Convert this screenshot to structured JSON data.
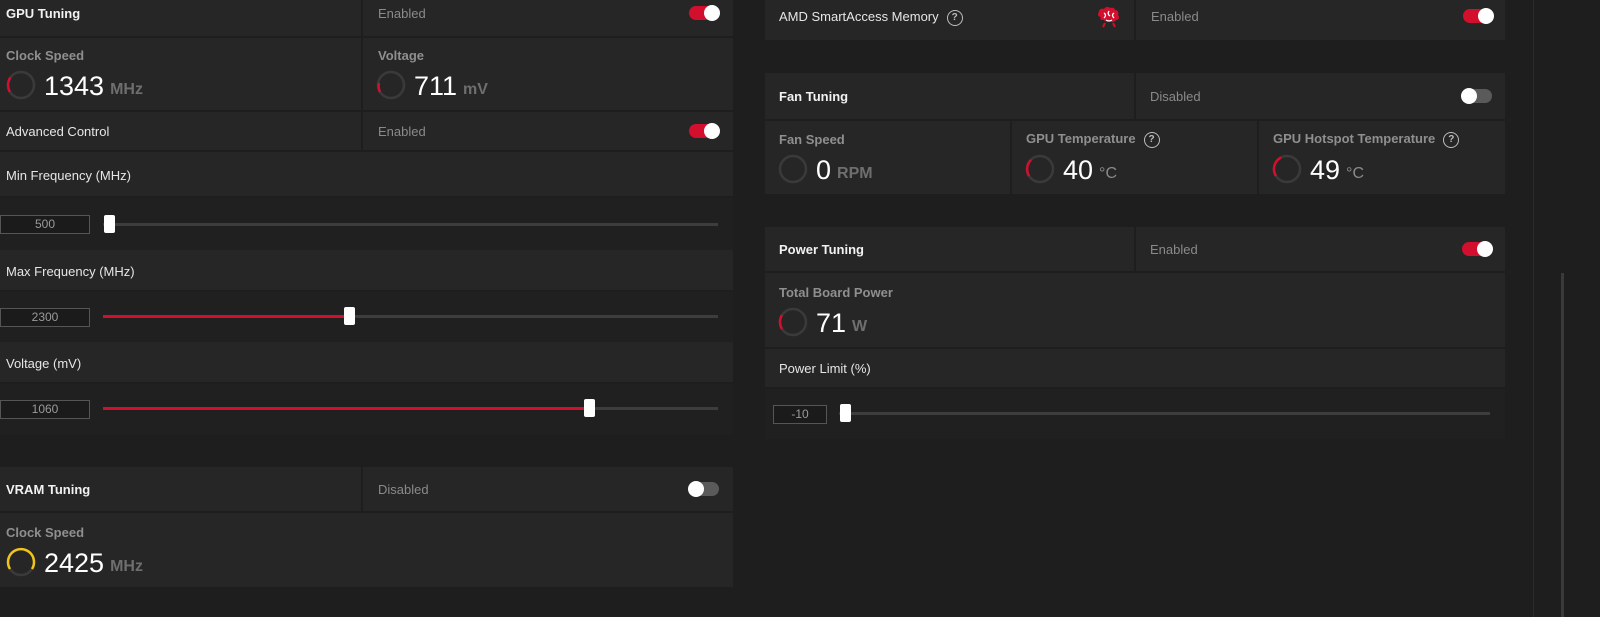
{
  "colors": {
    "accent": "#d2102e",
    "vram_gauge": "#f0c419",
    "background": "#1e1e1e",
    "panel": "#262626"
  },
  "gpu_tuning": {
    "title": "GPU Tuning",
    "state": "Enabled",
    "enabled": true,
    "clock_speed": {
      "label": "Clock Speed",
      "value": "1343",
      "unit": "MHz"
    },
    "voltage": {
      "label": "Voltage",
      "value": "711",
      "unit": "mV"
    },
    "advanced_control": {
      "label": "Advanced Control",
      "state": "Enabled",
      "enabled": true
    },
    "min_frequency": {
      "label": "Min Frequency (MHz)",
      "value": "500",
      "slider_fraction": 0.0
    },
    "max_frequency": {
      "label": "Max Frequency (MHz)",
      "value": "2300",
      "slider_fraction": 0.4
    },
    "voltage_slider": {
      "label": "Voltage (mV)",
      "value": "1060",
      "slider_fraction": 0.79
    }
  },
  "vram_tuning": {
    "title": "VRAM Tuning",
    "state": "Disabled",
    "enabled": false,
    "clock_speed": {
      "label": "Clock Speed",
      "value": "2425",
      "unit": "MHz"
    }
  },
  "smart_access": {
    "label": "AMD SmartAccess Memory",
    "help_icon": "question-circle-icon",
    "brain_icon": "brain-icon",
    "state": "Enabled",
    "enabled": true
  },
  "fan_tuning": {
    "title": "Fan Tuning",
    "state": "Disabled",
    "enabled": false,
    "fan_speed": {
      "label": "Fan Speed",
      "value": "0",
      "unit": "RPM"
    },
    "gpu_temperature": {
      "label": "GPU Temperature",
      "value": "40",
      "unit": "°C"
    },
    "hotspot_temperature": {
      "label": "GPU Hotspot Temperature",
      "value": "49",
      "unit": "°C"
    }
  },
  "power_tuning": {
    "title": "Power Tuning",
    "state": "Enabled",
    "enabled": true,
    "total_board_power": {
      "label": "Total Board Power",
      "value": "71",
      "unit": "W"
    },
    "power_limit": {
      "label": "Power Limit (%)",
      "value": "-10",
      "slider_fraction": 0.0
    }
  }
}
